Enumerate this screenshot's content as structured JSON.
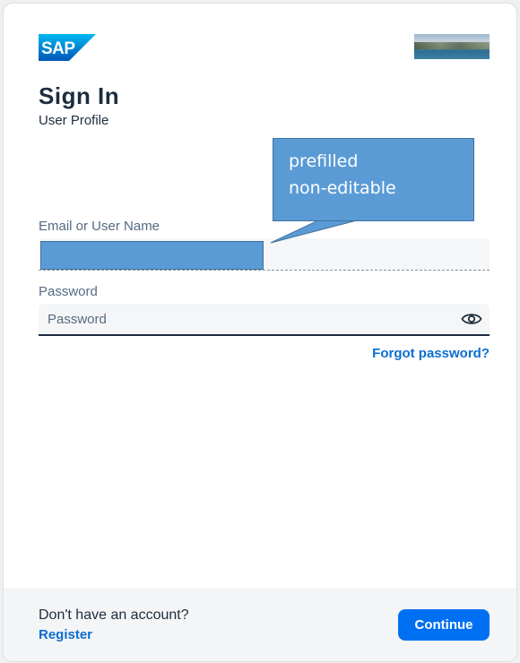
{
  "brand": {
    "logo_text": "SAP",
    "logo_color": "#0a7fc8"
  },
  "header": {
    "title": "Sign In",
    "subtitle": "User Profile"
  },
  "form": {
    "email": {
      "label": "Email or User Name",
      "value_redacted": true
    },
    "password": {
      "label": "Password",
      "placeholder": "Password",
      "value": ""
    },
    "forgot_link": "Forgot password?"
  },
  "callout": {
    "line1": "prefilled",
    "line2": "non-editable",
    "color": "#5b9bd5"
  },
  "footer": {
    "no_account_text": "Don't have an account?",
    "register_link": "Register",
    "continue_button": "Continue",
    "accent_color": "#0070f2"
  },
  "icons": {
    "logo": "sap-logo",
    "header_image": "landscape-image",
    "password_toggle": "eye-icon"
  }
}
